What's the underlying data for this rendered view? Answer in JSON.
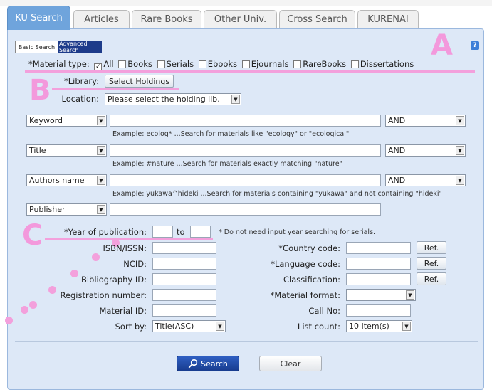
{
  "tabs": [
    "KU Search",
    "Articles",
    "Rare Books",
    "Other Univ.",
    "Cross Search",
    "KURENAI"
  ],
  "mode": {
    "basic": "Basic Search",
    "advanced": "Advanced Search"
  },
  "help": "?",
  "material_type": {
    "label": "*Material type:",
    "options": [
      {
        "label": "All",
        "checked": true
      },
      {
        "label": "Books",
        "checked": false
      },
      {
        "label": "Serials",
        "checked": false
      },
      {
        "label": "Ebooks",
        "checked": false
      },
      {
        "label": "Ejournals",
        "checked": false
      },
      {
        "label": "RareBooks",
        "checked": false
      },
      {
        "label": "Dissertations",
        "checked": false
      }
    ]
  },
  "library": {
    "label": "*Library:",
    "button": "Select Holdings"
  },
  "location": {
    "label": "Location:",
    "value": "Please select the holding lib."
  },
  "keyword_rows": [
    {
      "field": "Keyword",
      "op": "AND",
      "example": "Example: ecolog* ...Search for materials like \"ecology\" or \"ecological\""
    },
    {
      "field": "Title",
      "op": "AND",
      "example": "Example: #nature ...Search for materials exactly matching \"nature\""
    },
    {
      "field": "Authors name",
      "op": "AND",
      "example": "Example: yukawa^hideki ...Search for materials containing \"yukawa\" and not containing \"hideki\""
    },
    {
      "field": "Publisher"
    }
  ],
  "year": {
    "label": "*Year of publication:",
    "to": "to",
    "note": "* Do not need input year searching for serials."
  },
  "left_fields": {
    "isbn": "ISBN/ISSN:",
    "ncid": "NCID:",
    "bibid": "Bibliography ID:",
    "regnum": "Registration number:",
    "matid": "Material ID:",
    "sortby": "Sort by:",
    "sortby_value": "Title(ASC)"
  },
  "right_fields": {
    "country": "*Country code:",
    "language": "*Language code:",
    "classification": "Classification:",
    "format": "*Material format:",
    "format_value": "",
    "callno": "Call No:",
    "listcount": "List count:",
    "listcount_value": "10 Item(s)",
    "ref": "Ref."
  },
  "actions": {
    "search": "Search",
    "clear": "Clear"
  },
  "annotations": {
    "a": "A",
    "b": "B",
    "c": "C"
  },
  "colors": {
    "tab_active": "#6fa4dc",
    "panel_bg": "#dde8f7",
    "annotation_pink": "#f3a0dc",
    "search_button": "#1b3f96"
  }
}
